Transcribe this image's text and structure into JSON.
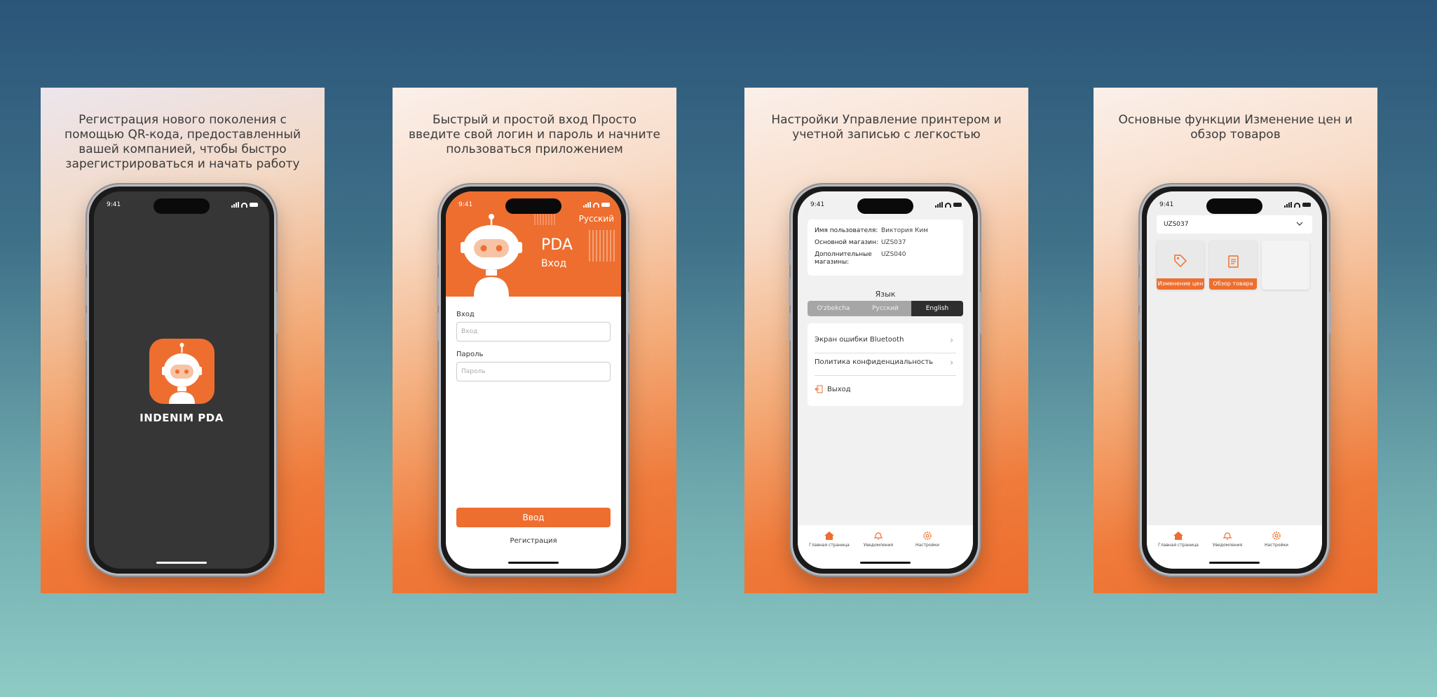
{
  "colors": {
    "accent": "#ee6e2f",
    "dark_screen": "#363636"
  },
  "status_time": "9:41",
  "cards": [
    {
      "title": "Регистрация нового поколения с помощью QR-кода, предоставленный вашей компанией, чтобы быстро зарегистрироваться и начать работу"
    },
    {
      "title": "Быстрый и простой вход Просто введите свой логин и пароль и начните пользоваться приложением"
    },
    {
      "title": "Настройки Управление принтером и учетной записью с легкостью"
    },
    {
      "title": "Основные функции Изменение цен и обзор товаров"
    }
  ],
  "splash": {
    "app_name": "INDENIM PDA",
    "icon": "robot-icon"
  },
  "login": {
    "language": "Русский",
    "app_title": "PDA",
    "subtitle": "Вход",
    "login_label": "Вход",
    "login_placeholder": "Вход",
    "password_label": "Пароль",
    "password_placeholder": "Пароль",
    "submit_label": "Ввод",
    "register_label": "Регистрация"
  },
  "settings": {
    "user_label": "Имя пользователя:",
    "user_value": "Виктория Ким",
    "main_store_label": "Основной магазин:",
    "main_store_value": "UZS037",
    "extra_stores_label": "Дополнительные магазины:",
    "extra_stores_value": "UZS040",
    "language_label": "Язык",
    "languages": [
      "O'zbekcha",
      "Русский",
      "English"
    ],
    "active_language": "English",
    "menu": {
      "bluetooth": "Экран ошибки Bluetooth",
      "privacy": "Политика конфиденциальность",
      "logout": "Выход"
    }
  },
  "tabs": {
    "home": "Главная страница",
    "notifications": "Уведомления",
    "settings": "Настройки"
  },
  "home": {
    "store_selected": "UZS037",
    "tiles": [
      "Изменение цен",
      "Обзор товара"
    ]
  }
}
